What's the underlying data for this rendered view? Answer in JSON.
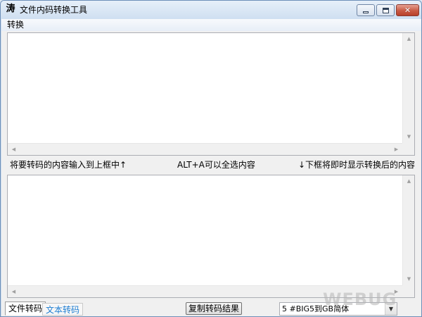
{
  "window": {
    "title": "文件内码转换工具",
    "logo": "涛"
  },
  "menu": {
    "items": [
      "转换"
    ]
  },
  "hints": {
    "left": "将要转码的内容输入到上框中↑",
    "middle": "ALT+A可以全选内容",
    "right": "↓下框将即时显示转换后的内容"
  },
  "bottom": {
    "tabs": [
      "文件转码",
      "文本转码"
    ],
    "copy_button": "复制转码结果",
    "select_value": "5 #BIG5到GB简体"
  },
  "watermark": "WEBUG",
  "icons": {
    "scroll_up": "chevron-up-icon",
    "scroll_down": "chevron-down-icon",
    "scroll_left": "chevron-left-icon",
    "scroll_right": "chevron-right-icon",
    "dropdown": "dropdown-arrow-icon"
  }
}
